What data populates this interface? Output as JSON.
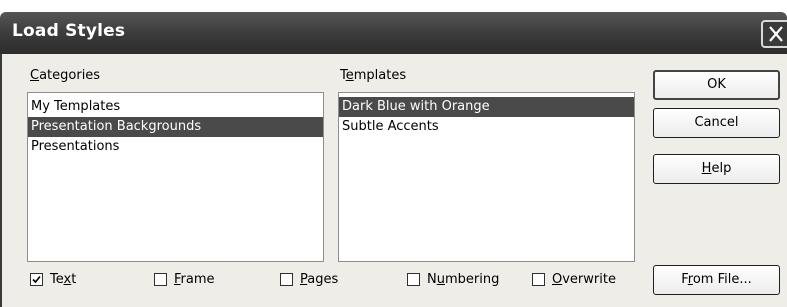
{
  "window": {
    "title": "Load Styles"
  },
  "categories": {
    "label": "Categories",
    "items": [
      "My Templates",
      "Presentation Backgrounds",
      "Presentations"
    ],
    "selected_index": 1
  },
  "templates": {
    "label": "Templates",
    "items": [
      "Dark Blue with Orange",
      "Subtle Accents"
    ],
    "selected_index": 0
  },
  "buttons": {
    "ok": "OK",
    "cancel": "Cancel",
    "help": "Help",
    "from_file": "From File..."
  },
  "options": [
    {
      "label": "Text",
      "checked": true
    },
    {
      "label": "Frame",
      "checked": false
    },
    {
      "label": "Pages",
      "checked": false
    },
    {
      "label": "Numbering",
      "checked": false
    },
    {
      "label": "Overwrite",
      "checked": false
    }
  ]
}
